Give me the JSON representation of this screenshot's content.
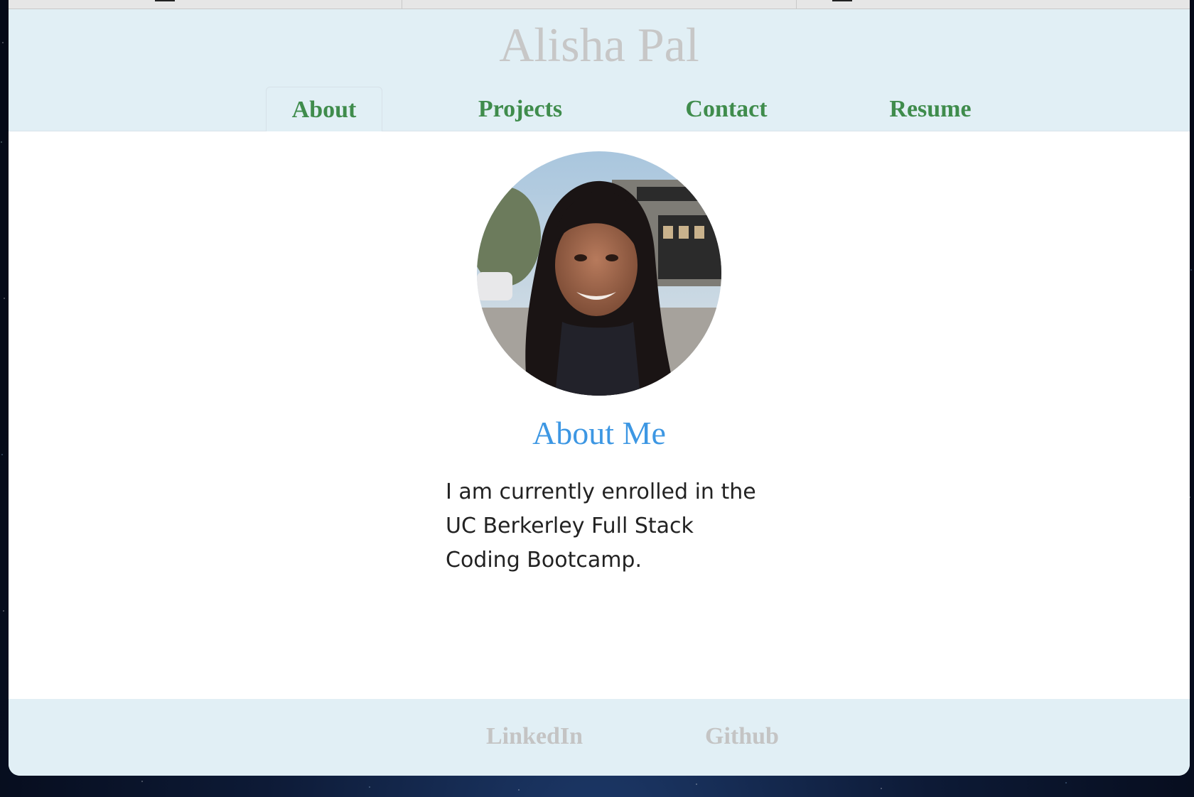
{
  "header": {
    "site_title": "Alisha Pal"
  },
  "nav": {
    "items": [
      {
        "label": "About",
        "active": true
      },
      {
        "label": "Projects",
        "active": false
      },
      {
        "label": "Contact",
        "active": false
      },
      {
        "label": "Resume",
        "active": false
      }
    ]
  },
  "about": {
    "heading": "About Me",
    "text": "I am currently enrolled in the UC Berkerley Full Stack Coding Bootcamp."
  },
  "footer": {
    "links": [
      "LinkedIn",
      "Github"
    ]
  },
  "colors": {
    "header_bg": "#e1eff5",
    "nav_link": "#3f8c4c",
    "heading": "#3d97e3",
    "muted": "#c4c4c4"
  },
  "icons": {
    "profile_photo": "avatar-photo"
  }
}
